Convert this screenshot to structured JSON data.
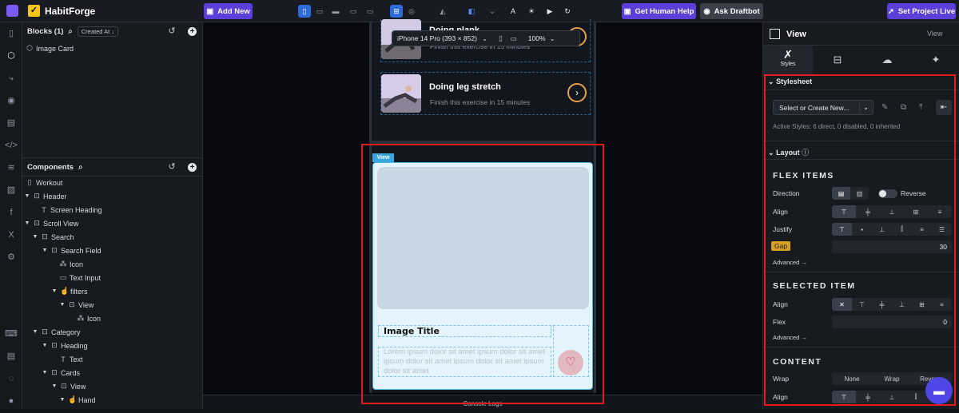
{
  "app": {
    "name": "HabitForge"
  },
  "topbar": {
    "add_new": "Add New",
    "get_help": "Get Human Help",
    "ask_draftbot": "Ask Draftbot",
    "set_live": "Set Project Live"
  },
  "blocks": {
    "title": "Blocks (1)",
    "sort": "Created At ↓",
    "items": [
      "Image Card"
    ]
  },
  "components": {
    "title": "Components",
    "tree": [
      {
        "label": "Workout",
        "icon": "page-icon"
      },
      {
        "label": "Header",
        "icon": "view-icon"
      },
      {
        "label": "Screen Heading",
        "icon": "text-icon"
      },
      {
        "label": "Scroll View",
        "icon": "view-icon"
      },
      {
        "label": "Search",
        "icon": "view-icon"
      },
      {
        "label": "Search Field",
        "icon": "view-icon"
      },
      {
        "label": "Icon",
        "icon": "icon-icon"
      },
      {
        "label": "Text Input",
        "icon": "input-icon"
      },
      {
        "label": "filters",
        "icon": "pressable-icon"
      },
      {
        "label": "View",
        "icon": "view-icon"
      },
      {
        "label": "Icon",
        "icon": "icon-icon"
      },
      {
        "label": "Category",
        "icon": "view-icon"
      },
      {
        "label": "Heading",
        "icon": "view-icon"
      },
      {
        "label": "Text",
        "icon": "text-icon"
      },
      {
        "label": "Cards",
        "icon": "view-icon"
      },
      {
        "label": "View",
        "icon": "view-icon"
      },
      {
        "label": "Hand",
        "icon": "pressable-icon"
      }
    ]
  },
  "canvas": {
    "device": "iPhone 14 Pro (393 × 852)",
    "zoom": "100%",
    "exercises": [
      {
        "title": "Doing plank",
        "subtitle": "Finish this exercise in 15 minutes"
      },
      {
        "title": "Doing leg stretch",
        "subtitle": "Finish this exercise in 15 minutes"
      }
    ],
    "selected_tag": "View",
    "card": {
      "title": "Image Title",
      "body": "Lorem ipsum dolor sit amet ipsum dolor sit amet ipsum dolor sit amet ipsum dolor sit amet ipsum dolor sit amet"
    },
    "console": "Console Logs"
  },
  "right": {
    "title": "View",
    "view_link": "View",
    "tab_styles": "Styles",
    "stylesheet": {
      "label": "Stylesheet",
      "select": "Select or Create New...",
      "active": "Active Styles: 6 direct, 0 disabled, 0 inherited"
    },
    "layout": {
      "label": "Layout"
    },
    "flex_items": {
      "heading": "FLEX ITEMS",
      "direction": "Direction",
      "reverse": "Reverse",
      "align": "Align",
      "justify": "Justify",
      "gap": "Gap",
      "gap_value": "30",
      "advanced": "Advanced →"
    },
    "selected_item": {
      "heading": "SELECTED ITEM",
      "align": "Align",
      "flex": "Flex",
      "flex_value": "0",
      "advanced": "Advanced →"
    },
    "content": {
      "heading": "CONTENT",
      "wrap": "Wrap",
      "wrap_options": [
        "None",
        "Wrap",
        "Reverse"
      ],
      "align": "Align"
    }
  }
}
